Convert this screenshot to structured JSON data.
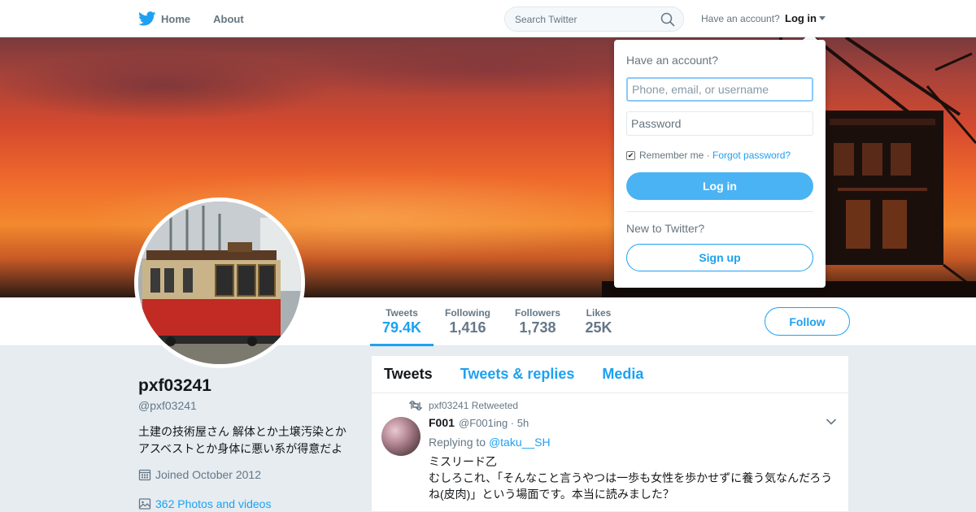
{
  "nav": {
    "home_label": "Home",
    "about_label": "About",
    "search_placeholder": "Search Twitter",
    "have_account": "Have an account?",
    "login_label": "Log in"
  },
  "stats": [
    {
      "label": "Tweets",
      "value": "79.4K"
    },
    {
      "label": "Following",
      "value": "1,416"
    },
    {
      "label": "Followers",
      "value": "1,738"
    },
    {
      "label": "Likes",
      "value": "25K"
    }
  ],
  "follow_label": "Follow",
  "profile": {
    "name": "pxf03241",
    "handle": "@pxf03241",
    "bio_line1": "土建の技術屋さん 解体とか土壌汚染とか",
    "bio_line2": "アスベストとか身体に悪い系が得意だよ",
    "joined": "Joined October 2012",
    "photos": "362 Photos and videos"
  },
  "timeline": {
    "tabs": [
      "Tweets",
      "Tweets & replies",
      "Media"
    ],
    "tweet": {
      "retweeted_by": "pxf03241 Retweeted",
      "name": "F001",
      "meta": "@F001ing · 5h",
      "replying_prefix": "Replying to ",
      "replying_to": "@taku__SH",
      "line1": "ミスリード乙",
      "line2": "むしろこれ、「そんなこと言うやつは一歩も女性を歩かせずに養う気なんだろう",
      "line3": "ね(皮肉)」という場面です。本当に読みました？"
    }
  },
  "login_dropdown": {
    "title": "Have an account?",
    "username_placeholder": "Phone, email, or username",
    "password_placeholder": "Password",
    "remember_label": "Remember me",
    "separator": " · ",
    "forgot_label": "Forgot password?",
    "login_button": "Log in",
    "new_label": "New to Twitter?",
    "signup_button": "Sign up"
  },
  "colors": {
    "accent": "#1da1f2",
    "login_button": "#4ab3f4",
    "background": "#e6ecf0"
  }
}
